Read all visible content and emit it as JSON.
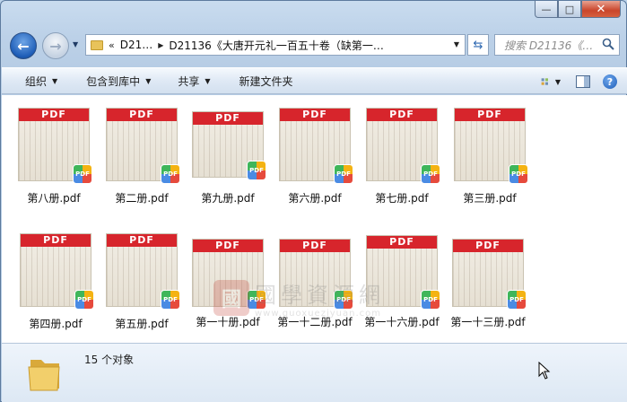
{
  "window": {
    "caption_buttons": {
      "minimize": "—",
      "maximize": "□",
      "close": "✕"
    }
  },
  "nav": {
    "back_icon": "back-arrow-icon",
    "forward_icon": "forward-arrow-icon",
    "breadcrumb": [
      "D21…",
      "D21136《大唐开元礼一百五十卷（缺第一…"
    ],
    "search_placeholder": "搜索 D21136《…"
  },
  "toolbar": {
    "organize": "组织",
    "include_library": "包含到库中",
    "share": "共享",
    "new_folder": "新建文件夹"
  },
  "files": [
    {
      "name": "第八册.pdf",
      "band": "PDF",
      "badge": "PDF"
    },
    {
      "name": "第二册.pdf",
      "band": "PDF",
      "badge": "PDF"
    },
    {
      "name": "第九册.pdf",
      "band": "PDF",
      "badge": "PDF"
    },
    {
      "name": "第六册.pdf",
      "band": "PDF",
      "badge": "PDF"
    },
    {
      "name": "第七册.pdf",
      "band": "PDF",
      "badge": "PDF"
    },
    {
      "name": "第三册.pdf",
      "band": "PDF",
      "badge": "PDF"
    },
    {
      "name": "第四册.pdf",
      "band": "PDF",
      "badge": "PDF"
    },
    {
      "name": "第五册.pdf",
      "band": "PDF",
      "badge": "PDF"
    },
    {
      "name": "第一十册.pdf",
      "band": "PDF",
      "badge": "PDF"
    },
    {
      "name": "第一十二册.pdf",
      "band": "PDF",
      "badge": "PDF"
    },
    {
      "name": "第一十六册.pdf",
      "band": "PDF",
      "badge": "PDF"
    },
    {
      "name": "第一十三册.pdf",
      "band": "PDF",
      "badge": "PDF"
    }
  ],
  "watermark": {
    "seal": "國",
    "title": "國學資源網",
    "url": "www.guoxueziyuan.com"
  },
  "status": {
    "count_text": "15 个对象"
  }
}
